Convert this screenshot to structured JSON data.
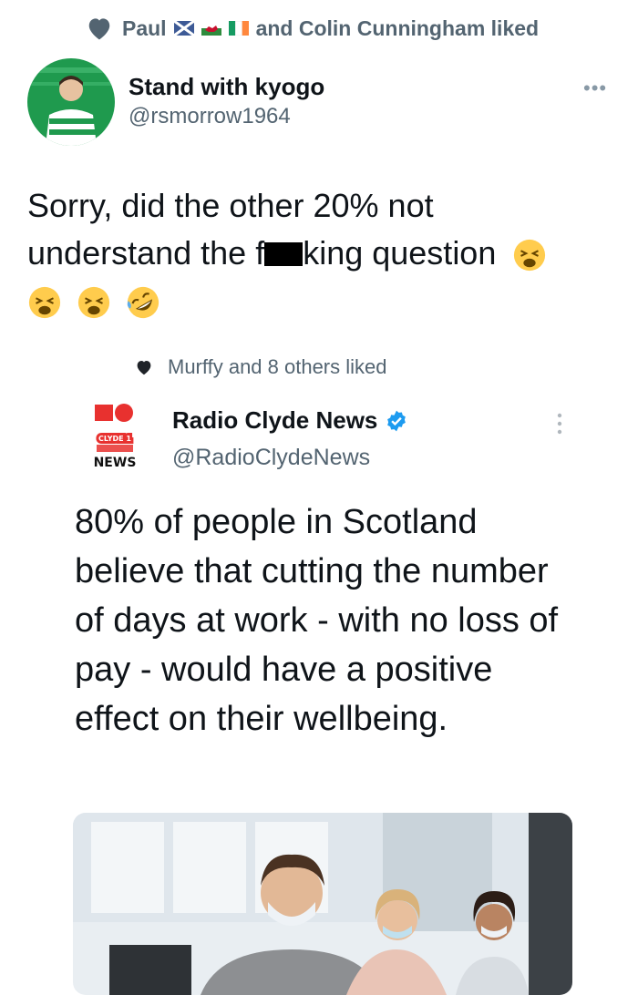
{
  "activity_top": {
    "text_name": "Paul",
    "text_rest": "and Colin Cunningham liked",
    "icons": [
      "heart-icon",
      "scotland-flag-icon",
      "wales-flag-icon",
      "ireland-flag-icon"
    ]
  },
  "tweet1": {
    "author_name": "Stand with kyogo",
    "handle": "@rsmorrow1964",
    "more_label": "•••",
    "text_line1": "Sorry, did the other 20% not",
    "text_before_redact": "understand the f",
    "text_after_redact": "king question",
    "emojis": [
      "weary-face",
      "weary-face",
      "weary-face",
      "rofl-face"
    ]
  },
  "activity_inner": {
    "text": "Murffy and 8 others liked"
  },
  "tweet2": {
    "author_name": "Radio Clyde News",
    "handle": "@RadioClydeNews",
    "logo_top_text": "CLYDE 1",
    "logo_bottom_text": "NEWS",
    "text": "80% of people in Scotland believe that cutting the number of days at work - with no loss of pay - would have a positive effect on their wellbeing."
  },
  "colors": {
    "text_primary": "#0f1419",
    "text_secondary": "#536471",
    "verified_blue": "#1d9bf0",
    "logo_red": "#e8312f"
  }
}
